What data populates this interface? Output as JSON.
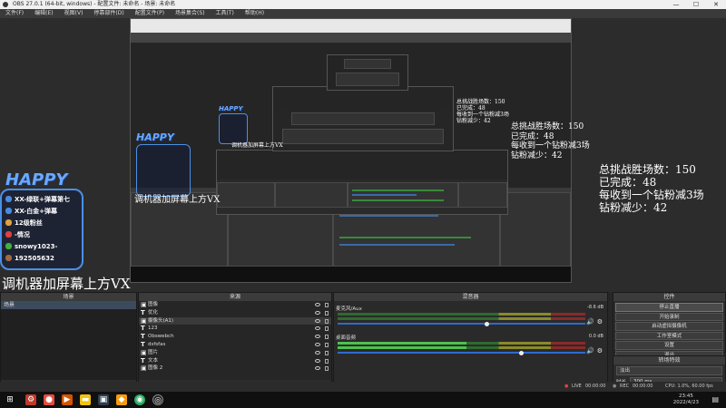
{
  "window": {
    "title": "OBS 27.0.1 (64-bit, windows) - 配置文件: 未命名 - 场景: 未命名",
    "minimize": "—",
    "maximize": "☐",
    "close": "✕"
  },
  "menu": [
    "文件(F)",
    "编辑(E)",
    "视图(V)",
    "停靠部件(D)",
    "配置文件(P)",
    "场景集合(S)",
    "工具(T)",
    "帮助(H)"
  ],
  "overlay": {
    "stats_lines": [
      "总挑战胜场数：150",
      "已完成：48",
      "每收到一个钻粉减3场",
      "钻粉减少：42"
    ],
    "caption": "调机器加屏幕上方VX",
    "sticker": {
      "logo": "HAPPY",
      "lines": [
        "XX-绿联+弹幕第七",
        "XX-白金+弹幕",
        "12级粉丝",
        "-情况",
        "snowy1023-",
        "192505632"
      ]
    }
  },
  "docks": {
    "scenes": {
      "title": "场景",
      "items": [
        "场景"
      ],
      "add": "+",
      "remove": "−",
      "up": "⌃",
      "down": "⌄"
    },
    "sources": {
      "title": "来源",
      "items": [
        "图像",
        "优化",
        "摄像头(A1)",
        "123",
        "Obswebch",
        "dsfsfas",
        "图片",
        "文本",
        "图像 2"
      ],
      "add": "+",
      "remove": "−",
      "settings": "⚙",
      "up": "⌃",
      "down": "⌄"
    },
    "mixer": {
      "title": "混音器",
      "channels": [
        {
          "name": "麦克风/Aux",
          "db": "-8.6 dB",
          "volume": 0.6
        },
        {
          "name": "桌面音频",
          "db": "0.0 dB",
          "volume": 0.74
        }
      ]
    },
    "controls": {
      "title": "控件",
      "buttons": [
        "停止直播",
        "开始录制",
        "启动虚拟摄像机",
        "工作室模式",
        "设置",
        "退出"
      ]
    },
    "transitions": {
      "title": "转场特效",
      "selected": "淡出",
      "duration_label": "时长",
      "duration_value": "300 ms"
    }
  },
  "status": {
    "live_label": "LIVE",
    "live_time": "00:00:00",
    "rec_label": "REC",
    "rec_time": "00:00:00",
    "cpu": "CPU: 1.0%, 60.00 fps"
  },
  "taskbar": {
    "time": "23:45",
    "date": "2022/4/23",
    "icons": [
      "windows-logo",
      "settings",
      "media",
      "folder",
      "store",
      "chrome",
      "obs"
    ]
  }
}
